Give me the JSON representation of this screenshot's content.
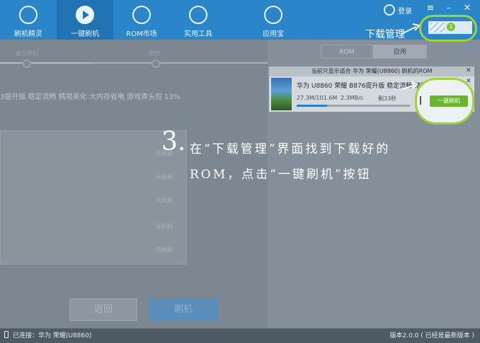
{
  "nav": {
    "items": [
      {
        "label": "刷机精灵",
        "icon": "shield-icon"
      },
      {
        "label": "一键刷机",
        "icon": "play-icon",
        "active": true
      },
      {
        "label": "ROM市场",
        "icon": "rom-icon"
      },
      {
        "label": "实用工具",
        "icon": "grid-icon"
      },
      {
        "label": "应用宝",
        "icon": "app-store-icon"
      }
    ],
    "login": "登录"
  },
  "annotation": {
    "download_manager": "下载管理",
    "step_number": "3.",
    "step_line1": "在“下载管理”界面找到下载好的",
    "step_line2": "ROM，点击“一键刷机”按钮"
  },
  "download_panel": {
    "badge_count": "1",
    "tabs": [
      "ROM",
      "应用"
    ],
    "active_tab": "应用",
    "notice": "当前只显示适合 华为 荣耀(U8860) 刷机的ROM",
    "card": {
      "title": "华为 U8860 荣耀 B876提升版 稳定流畅 精简美化 大内存省...",
      "size": "27.3M/101.6M",
      "speed": "2.3MB/s",
      "remaining": "剩33秒",
      "progress": 0.27,
      "action": "一键刷机"
    }
  },
  "left": {
    "steps": [
      "备份资料",
      "刷机"
    ],
    "rom_desc": "3提升版 稳定流畅 精简美化 大内存省电 游戏青头包  13%",
    "list_rows": [
      "无刷刷",
      "无刷刷",
      "无刷刷",
      "无刷刷",
      "无刷刷"
    ],
    "back": "返回",
    "flash": "刷机"
  },
  "status": {
    "connected": "已连接：华为 荣耀(U8860)",
    "version": "版本2.0.0 ( 已经是最新版本 )"
  },
  "colors": {
    "accent": "#2a86c8",
    "highlight": "#9fd33a",
    "action": "#69b62c"
  }
}
